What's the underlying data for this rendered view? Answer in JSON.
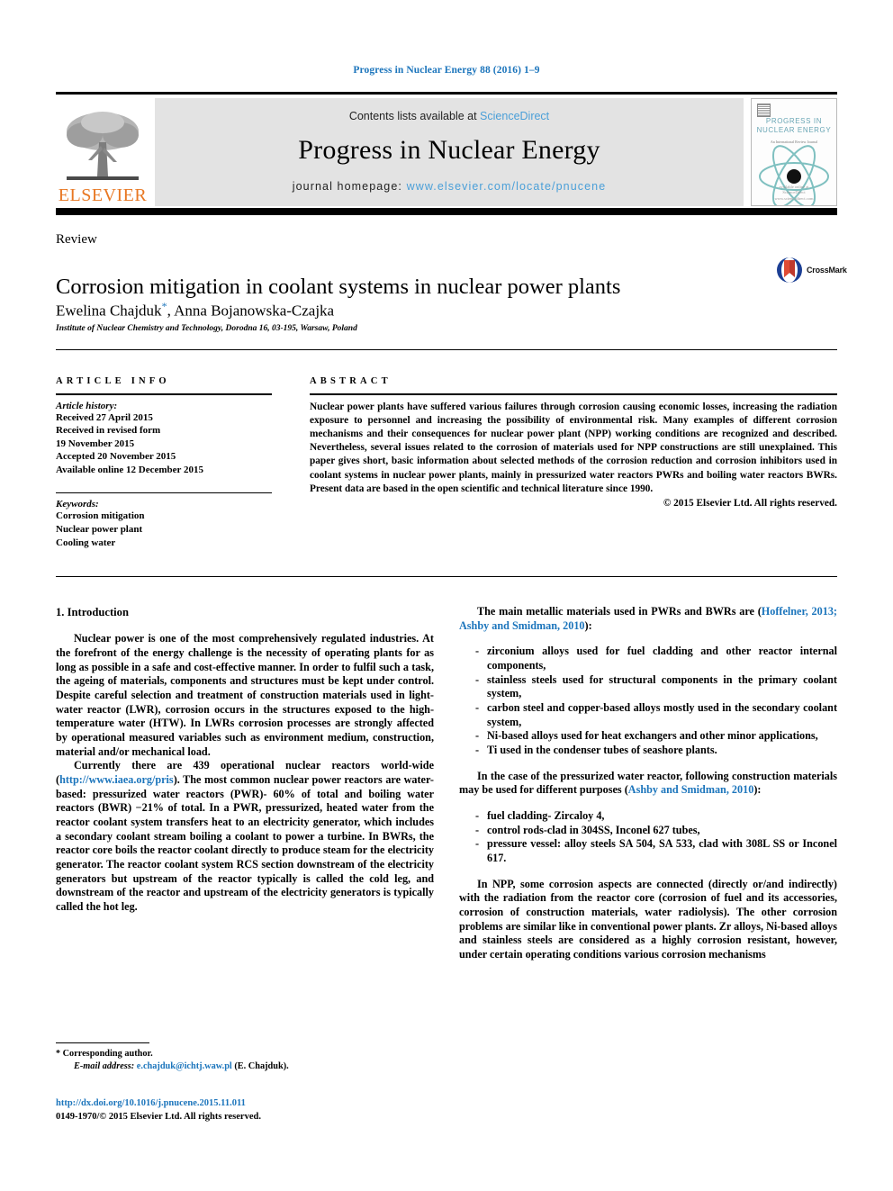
{
  "running_head": "Progress in Nuclear Energy 88 (2016) 1–9",
  "masthead": {
    "contents_prefix": "Contents lists available at ",
    "sciencedirect": "ScienceDirect",
    "journal_title": "Progress in Nuclear Energy",
    "homepage_label": "journal homepage: ",
    "homepage_url": "www.elsevier.com/locate/pnucene",
    "publisher": "ELSEVIER",
    "cover": {
      "title_line1": "PROGRESS IN",
      "title_line2": "NUCLEAR ENERGY",
      "subtitle": "An International Review Journal",
      "footer_line1": "available online at",
      "footer_line2": "ScienceDirect",
      "footer_line3": "www.sciencedirect.com"
    },
    "accent_blue": "#4a9fd8",
    "elsevier_orange": "#E87722",
    "band_grey": "#e3e3e3"
  },
  "article": {
    "doctype": "Review",
    "title": "Corrosion mitigation in coolant systems in nuclear power plants",
    "authors": "Ewelina Chajduk",
    "authors_rest": ", Anna Bojanowska-Czajka",
    "corresponding_marker": "*",
    "affiliation": "Institute of Nuclear Chemistry and Technology, Dorodna 16, 03-195, Warsaw, Poland",
    "crossmark_label": "CrossMark"
  },
  "info": {
    "heading": "ARTICLE INFO",
    "history_label": "Article history:",
    "history": [
      "Received 27 April 2015",
      "Received in revised form",
      "19 November 2015",
      "Accepted 20 November 2015",
      "Available online 12 December 2015"
    ],
    "keywords_label": "Keywords:",
    "keywords": [
      "Corrosion mitigation",
      "Nuclear power plant",
      "Cooling water"
    ]
  },
  "abstract": {
    "heading": "ABSTRACT",
    "text": "Nuclear power plants have suffered various failures through corrosion causing economic losses, increasing the radiation exposure to personnel and increasing the possibility of environmental risk. Many examples of different corrosion mechanisms and their consequences for nuclear power plant (NPP) working conditions are recognized and described. Nevertheless, several issues related to the corrosion of materials used for NPP constructions are still unexplained. This paper gives short, basic information about selected methods of the corrosion reduction and corrosion inhibitors used in coolant systems in nuclear power plants, mainly in pressurized water reactors PWRs and boiling water reactors BWRs. Present data are based in the open scientific and technical literature since 1990.",
    "copyright": "© 2015 Elsevier Ltd. All rights reserved."
  },
  "body": {
    "section_number_title": "1. Introduction",
    "left_paragraph_1": "Nuclear power is one of the most comprehensively regulated industries. At the forefront of the energy challenge is the necessity of operating plants for as long as possible in a safe and cost-effective manner. In order to fulfil such a task, the ageing of materials, components and structures must be kept under control. Despite careful selection and treatment of construction materials used in light-water reactor (LWR), corrosion occurs in the structures exposed to the high-temperature water (HTW). In LWRs corrosion processes are strongly affected by operational measured variables such as environment medium, construction, material and/or mechanical load.",
    "left_paragraph_2_pre": "Currently there are 439 operational nuclear reactors world-wide (",
    "left_paragraph_2_link": "http://www.iaea.org/pris",
    "left_paragraph_2_post": "). The most common nuclear power reactors are water-based: pressurized water reactors (PWR)- 60% of total and boiling water reactors (BWR) −21% of total. In a PWR, pressurized, heated water from the reactor coolant system transfers heat to an electricity generator, which includes a secondary coolant stream boiling a coolant to power a turbine. In BWRs, the reactor core boils the reactor coolant directly to produce steam for the electricity generator. The reactor coolant system RCS section downstream of the electricity generators but upstream of the reactor typically is called the cold leg, and downstream of the reactor and upstream of the electricity generators is typically called the hot leg.",
    "right_paragraph_1_pre": "The main metallic materials used in PWRs and BWRs are (",
    "right_paragraph_1_cite": "Hoffelner, 2013; Ashby and Smidman, 2010",
    "right_paragraph_1_post": "):",
    "materials_list": [
      "zirconium alloys used for fuel cladding and other reactor internal components,",
      "stainless steels used for structural components in the primary coolant system,",
      "carbon steel and copper-based alloys mostly used in the secondary coolant system,",
      "Ni-based alloys used for heat exchangers and other minor applications,",
      "Ti used in the condenser tubes of seashore plants."
    ],
    "right_paragraph_2_pre": "In the case of the pressurized water reactor, following construction materials may be used for different purposes (",
    "right_paragraph_2_cite": "Ashby and Smidman, 2010",
    "right_paragraph_2_post": "):",
    "pwr_list": [
      "fuel cladding- Zircaloy 4,",
      "control rods-clad in 304SS, Inconel 627 tubes,",
      "pressure vessel: alloy steels SA 504, SA 533, clad with 308L SS or Inconel 617."
    ],
    "right_paragraph_3": "In NPP, some corrosion aspects are connected (directly or/and indirectly) with the radiation from the reactor core (corrosion of fuel and its accessories, corrosion of construction materials, water radiolysis). The other corrosion problems are similar like in conventional power plants. Zr alloys, Ni-based alloys and stainless steels are considered as a highly corrosion resistant, however, under certain operating conditions various corrosion mechanisms"
  },
  "footnote": {
    "corresponding_marker": "*",
    "corresponding_text": "Corresponding author.",
    "email_label": "E-mail address:",
    "email": "e.chajduk@ichtj.waw.pl",
    "email_owner": "(E. Chajduk)."
  },
  "doi": {
    "url": "http://dx.doi.org/10.1016/j.pnucene.2015.11.011",
    "issn_line": "0149-1970/© 2015 Elsevier Ltd. All rights reserved."
  }
}
